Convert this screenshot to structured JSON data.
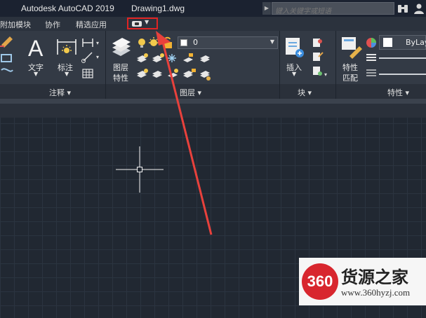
{
  "titlebar": {
    "app_title": "Autodesk AutoCAD 2019",
    "doc_title": "Drawing1.dwg",
    "search_placeholder": "键入关键字或短语"
  },
  "menu": {
    "tabs": [
      "附加模块",
      "协作",
      "精选应用"
    ]
  },
  "ribbon": {
    "annotate": {
      "text_label": "文字",
      "dimension_label": "标注",
      "group_label": "注释 ▾"
    },
    "layers": {
      "layer_properties_label_1": "图层",
      "layer_properties_label_2": "特性",
      "current_layer": "0",
      "group_label": "图层 ▾"
    },
    "block": {
      "insert_label": "插入",
      "group_label": "块 ▾"
    },
    "properties": {
      "match_label_1": "特性",
      "match_label_2": "匹配",
      "color_value": "ByLayer",
      "group_label": "特性 ▾"
    }
  },
  "watermark": {
    "logo_text": "360",
    "name": "货源之家",
    "url": "www.360hyzj.com"
  },
  "colors": {
    "highlight": "#e02424",
    "arrow": "#e8413c",
    "background": "#212832"
  }
}
